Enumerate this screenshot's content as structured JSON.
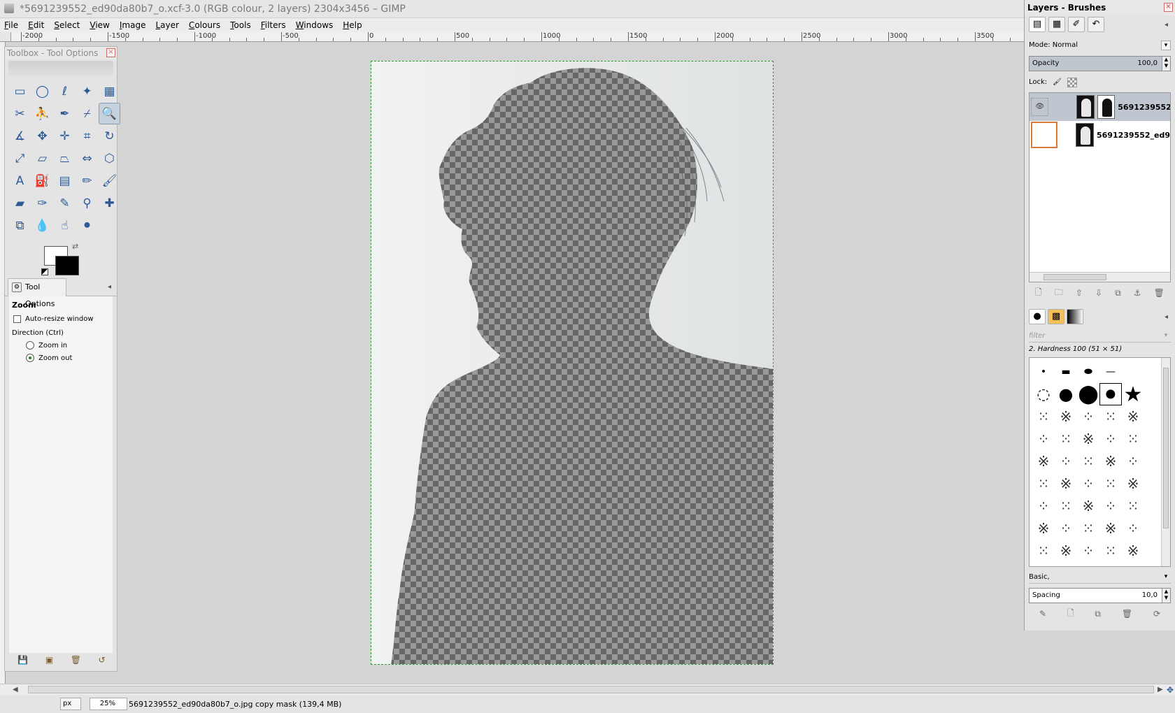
{
  "window": {
    "title": "*5691239552_ed90da80b7_o.xcf-3.0 (RGB colour, 2 layers) 2304x3456 – GIMP"
  },
  "menu": [
    "File",
    "Edit",
    "Select",
    "View",
    "Image",
    "Layer",
    "Colours",
    "Tools",
    "Filters",
    "Windows",
    "Help"
  ],
  "ruler": {
    "labels": [
      "-2000",
      "-1500",
      "-1000",
      "-500",
      "0",
      "500",
      "1000",
      "1500",
      "2000",
      "2500",
      "3000",
      "3500"
    ]
  },
  "toolbox": {
    "title": "Toolbox - Tool Options",
    "tools": [
      {
        "name": "rect-select-tool-icon",
        "glyph": "▭"
      },
      {
        "name": "ellipse-select-tool-icon",
        "glyph": "◯"
      },
      {
        "name": "free-select-tool-icon",
        "glyph": "ℓ"
      },
      {
        "name": "fuzzy-select-tool-icon",
        "glyph": "✦"
      },
      {
        "name": "select-by-color-tool-icon",
        "glyph": "▦"
      },
      {
        "name": "scissors-tool-icon",
        "glyph": "✂"
      },
      {
        "name": "foreground-select-tool-icon",
        "glyph": "⛹"
      },
      {
        "name": "paths-tool-icon",
        "glyph": "✒"
      },
      {
        "name": "color-picker-tool-icon",
        "glyph": "⌿"
      },
      {
        "name": "zoom-tool-icon",
        "glyph": "🔍"
      },
      {
        "name": "measure-tool-icon",
        "glyph": "∡"
      },
      {
        "name": "move-tool-icon",
        "glyph": "✥"
      },
      {
        "name": "align-tool-icon",
        "glyph": "✛"
      },
      {
        "name": "crop-tool-icon",
        "glyph": "⌗"
      },
      {
        "name": "rotate-tool-icon",
        "glyph": "↻"
      },
      {
        "name": "scale-tool-icon",
        "glyph": "⤢"
      },
      {
        "name": "shear-tool-icon",
        "glyph": "▱"
      },
      {
        "name": "perspective-tool-icon",
        "glyph": "⏢"
      },
      {
        "name": "flip-tool-icon",
        "glyph": "⇔"
      },
      {
        "name": "cage-tool-icon",
        "glyph": "⬡"
      },
      {
        "name": "text-tool-icon",
        "glyph": "A"
      },
      {
        "name": "bucket-fill-tool-icon",
        "glyph": "⛽"
      },
      {
        "name": "blend-tool-icon",
        "glyph": "▤"
      },
      {
        "name": "pencil-tool-icon",
        "glyph": "✏"
      },
      {
        "name": "paintbrush-tool-icon",
        "glyph": "🖌"
      },
      {
        "name": "eraser-tool-icon",
        "glyph": "▰"
      },
      {
        "name": "airbrush-tool-icon",
        "glyph": "✑"
      },
      {
        "name": "ink-tool-icon",
        "glyph": "✎"
      },
      {
        "name": "clone-tool-icon",
        "glyph": "⚲"
      },
      {
        "name": "heal-tool-icon",
        "glyph": "✚"
      },
      {
        "name": "perspective-clone-tool-icon",
        "glyph": "⧉"
      },
      {
        "name": "blur-tool-icon",
        "glyph": "💧"
      },
      {
        "name": "smudge-tool-icon",
        "glyph": "☝"
      },
      {
        "name": "dodge-burn-tool-icon",
        "glyph": "⚫"
      }
    ],
    "tool_options_tab": "Tool Options",
    "zoom_heading": "Zoom",
    "auto_resize": "Auto-resize window",
    "direction_label": "Direction  (Ctrl)",
    "zoom_in": "Zoom in",
    "zoom_out": "Zoom out"
  },
  "layers": {
    "title": "Layers - Brushes",
    "mode_label": "Mode: Normal",
    "opacity_label": "Opacity",
    "opacity_value": "100,0",
    "lock_label": "Lock:",
    "items": [
      {
        "name": "5691239552"
      },
      {
        "name": "5691239552_ed9"
      }
    ]
  },
  "brushes": {
    "filter_placeholder": "filter",
    "selected": "2. Hardness 100 (51 × 51)",
    "preset": "Basic,",
    "spacing_label": "Spacing",
    "spacing_value": "10,0"
  },
  "status": {
    "unit": "px",
    "zoom": "25%",
    "message": "5691239552_ed90da80b7_o.jpg copy mask (139,4 MB)"
  }
}
